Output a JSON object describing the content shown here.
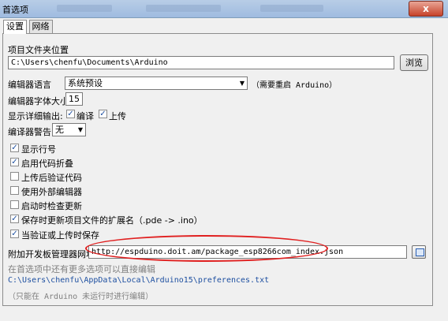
{
  "window": {
    "title": "首选项",
    "close_label": "x"
  },
  "tabs": [
    {
      "label": "设置"
    },
    {
      "label": "网络"
    }
  ],
  "sketchbook": {
    "label": "项目文件夹位置",
    "path": "C:\\Users\\chenfu\\Documents\\Arduino",
    "browse_label": "浏览"
  },
  "editor_language": {
    "label": "编辑器语言",
    "value": "系统预设",
    "note": "（需要重启 Arduino）"
  },
  "font_size": {
    "label": "编辑器字体大小",
    "value": "15"
  },
  "verbose": {
    "label": "显示详细输出:",
    "compile_label": "编译",
    "upload_label": "上传",
    "compile_checked": true,
    "upload_checked": true
  },
  "compiler_warnings": {
    "label": "编译器警告:",
    "value": "无"
  },
  "options": [
    {
      "label": "显示行号",
      "checked": true
    },
    {
      "label": "启用代码折叠",
      "checked": true
    },
    {
      "label": "上传后验证代码",
      "checked": false
    },
    {
      "label": "使用外部编辑器",
      "checked": false
    },
    {
      "label": "启动时检查更新",
      "checked": false
    },
    {
      "label": "保存时更新项目文件的扩展名（.pde -> .ino）",
      "checked": true
    },
    {
      "label": "当验证或上传时保存",
      "checked": true
    }
  ],
  "board_manager": {
    "label": "附加开发板管理器网址",
    "value": "http://espduino.doit.am/package_esp8266com_index.json"
  },
  "footer": {
    "note": "在首选项中还有更多选项可以直接编辑",
    "prefs_path": "C:\\Users\\chenfu\\AppData\\Local\\Arduino15\\preferences.txt",
    "hint": "（只能在 Arduino 未运行时进行编辑）"
  }
}
